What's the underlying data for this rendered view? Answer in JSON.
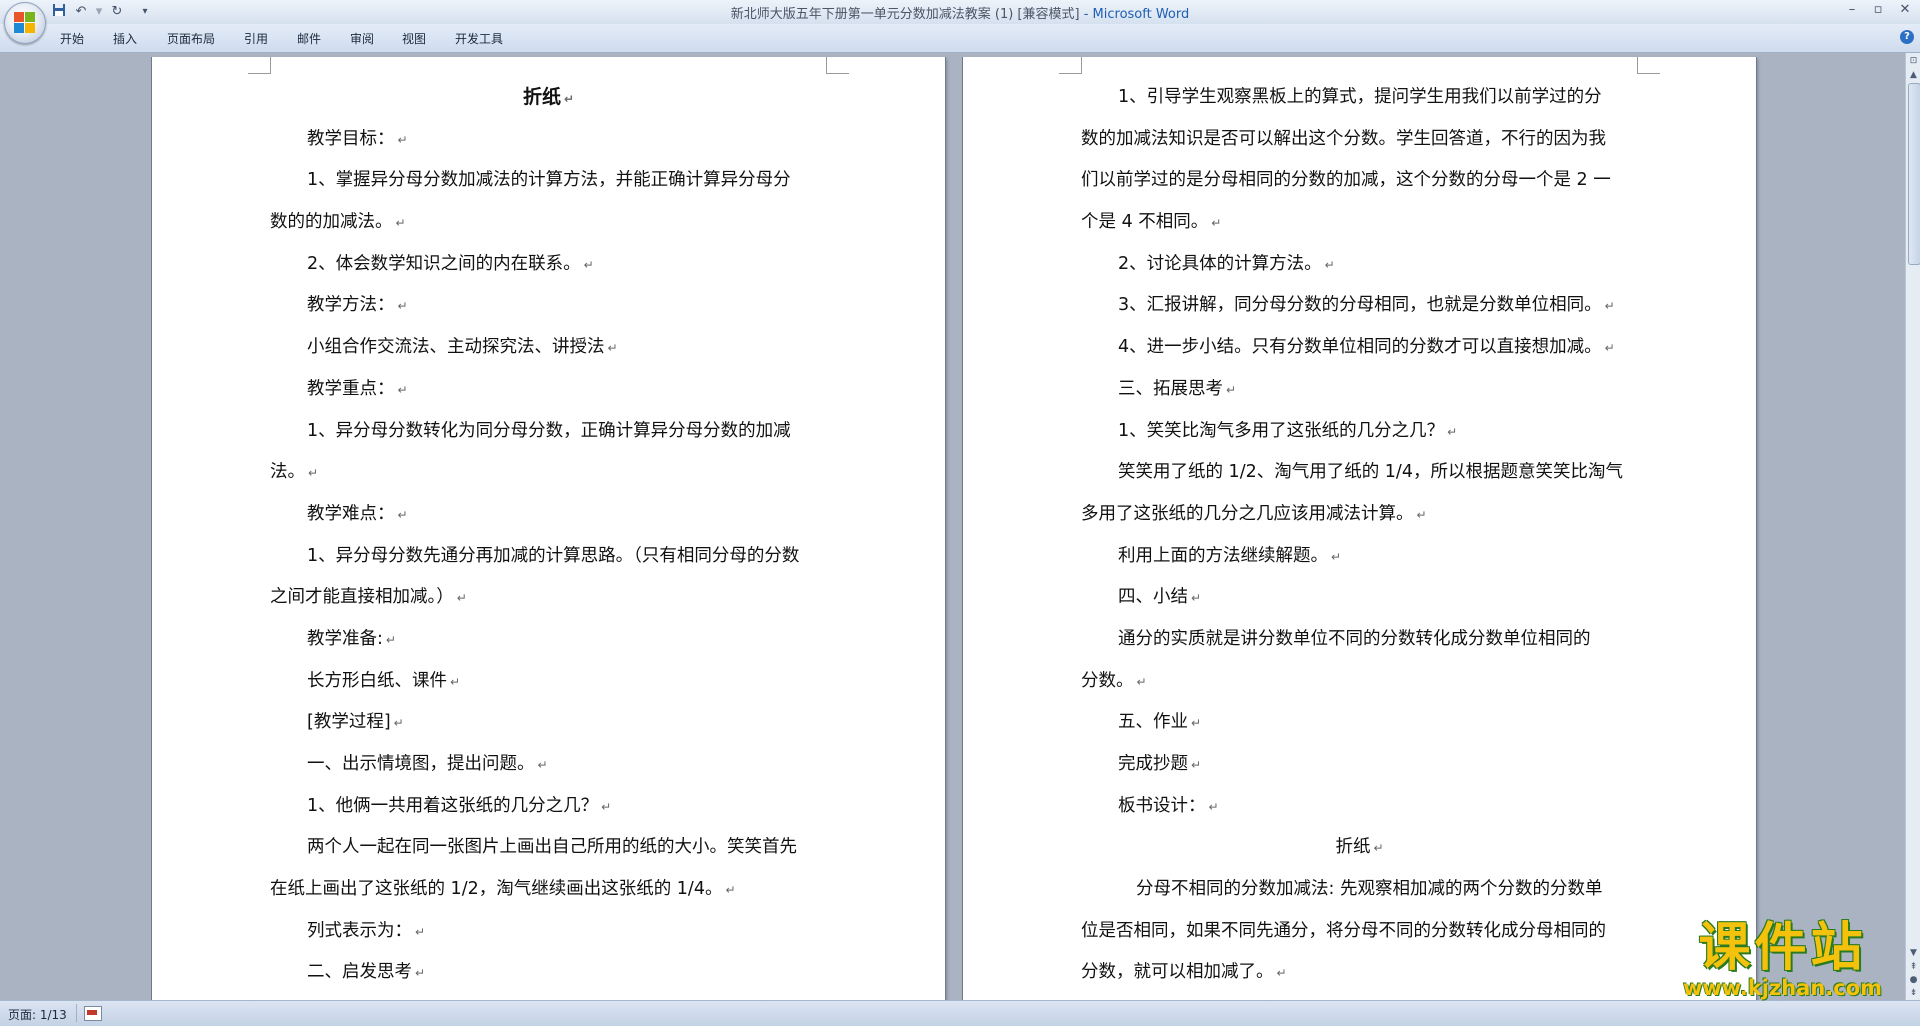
{
  "window": {
    "title": "新北师大版五年下册第一单元分数加减法教案 (1) [兼容模式]",
    "app_suffix": "- Microsoft Word"
  },
  "quick_access": {
    "save_icon": "save-icon",
    "undo_icon": "undo-icon",
    "redo_icon": "redo-icon",
    "customize": "▾"
  },
  "ribbon_tabs": [
    "开始",
    "插入",
    "页面布局",
    "引用",
    "邮件",
    "审阅",
    "视图",
    "开发工具"
  ],
  "window_controls": {
    "minimize": "–",
    "maximize": "▫",
    "close": "✕"
  },
  "page_left": {
    "title": "折纸",
    "lines": [
      "教学目标：",
      "1、掌握异分母分数加减法的计算方法，并能正确计算异分母分",
      "数的的加减法。",
      "2、体会数学知识之间的内在联系。",
      "教学方法：",
      "小组合作交流法、主动探究法、讲授法",
      "教学重点：",
      "1、异分母分数转化为同分母分数，正确计算异分母分数的加减",
      "法。",
      "教学难点：",
      "1、异分母分数先通分再加减的计算思路。（只有相同分母的分数",
      "之间才能直接相加减。）",
      "教学准备:",
      "长方形白纸、课件",
      "[教学过程]",
      "一、出示情境图，提出问题。",
      "1、他俩一共用着这张纸的几分之几？",
      "两个人一起在同一张图片上画出自己所用的纸的大小。笑笑首先",
      "在纸上画出了这张纸的 1/2，淘气继续画出这张纸的 1/4。",
      "列式表示为：",
      "二、启发思考"
    ]
  },
  "page_right": {
    "lines": [
      "1、引导学生观察黑板上的算式，提问学生用我们以前学过的分",
      "数的加减法知识是否可以解出这个分数。学生回答道，不行的因为我",
      "们以前学过的是分母相同的分数的加减，这个分数的分母一个是 2 一",
      "个是 4 不相同。",
      "2、讨论具体的计算方法。",
      "3、汇报讲解，同分母分数的分母相同，也就是分数单位相同。",
      "4、进一步小结。只有分数单位相同的分数才可以直接想加减。",
      "三、拓展思考",
      "1、笑笑比淘气多用了这张纸的几分之几？",
      "笑笑用了纸的 1/2、淘气用了纸的 1/4，所以根据题意笑笑比淘气",
      "多用了这张纸的几分之几应该用减法计算。",
      "利用上面的方法继续解题。",
      "四、小结",
      "通分的实质就是讲分数单位不同的分数转化成分数单位相同的",
      "分数。",
      "五、作业",
      "完成抄题",
      "板书设计：",
      "折纸",
      "分母不相同的分数加减法: 先观察相加减的两个分数的分数单",
      "位是否相同，如果不同先通分，将分母不同的分数转化成分母相同的",
      "分数，就可以相加减了。"
    ]
  },
  "status": {
    "page_info": "页面: 1/13"
  },
  "watermark": {
    "brand": "课件站",
    "url": "www.kjzhan.com"
  }
}
